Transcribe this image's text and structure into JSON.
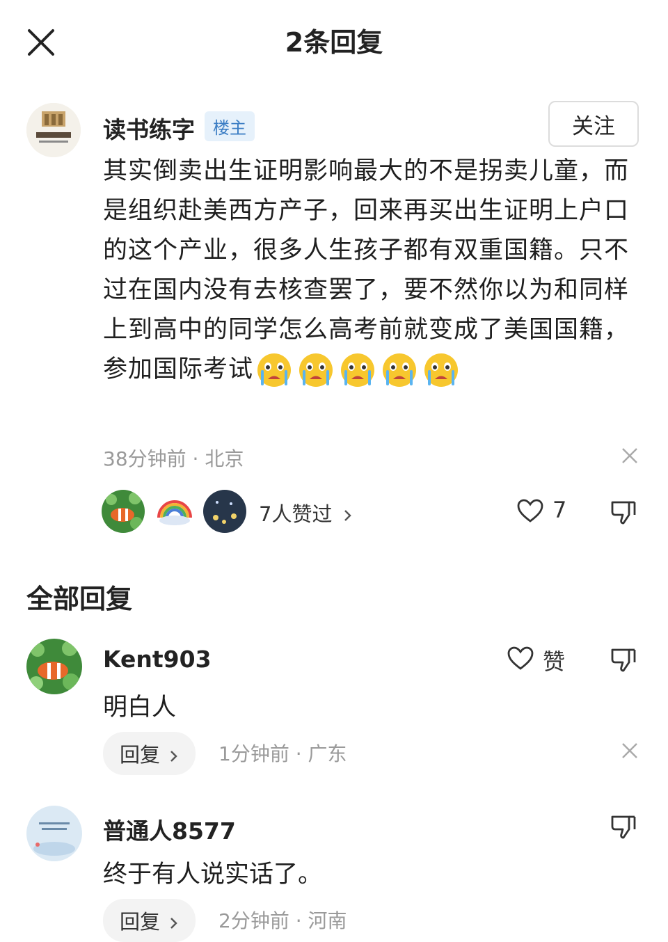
{
  "header": {
    "title": "2条回复"
  },
  "main_comment": {
    "author": "读书练字",
    "author_badge": "楼主",
    "follow_label": "关注",
    "text": "其实倒卖出生证明影响最大的不是拐卖儿童，而是组织赴美西方产子，回来再买出生证明上户口的这个产业，很多人生孩子都有双重国籍。只不过在国内没有去核查罢了，要不然你以为和同样上到高中的同学怎么高考前就变成了美国国籍，参加国际考试",
    "emoji_count": 5,
    "time": "38分钟前",
    "location": "北京",
    "likers_text": "7人赞过",
    "like_count": "7"
  },
  "replies_section": {
    "title": "全部回复"
  },
  "replies": [
    {
      "author": "Kent903",
      "text": "明白人",
      "like_label": "赞",
      "reply_label": "回复",
      "time": "1分钟前",
      "location": "广东"
    },
    {
      "author": "普通人8577",
      "text": "终于有人说实话了。",
      "reply_label": "回复",
      "time": "2分钟前",
      "location": "河南"
    }
  ],
  "icons": [
    "close-icon",
    "heart-icon",
    "thumb-down-icon",
    "chevron-right-icon",
    "dismiss-icon",
    "crying-face-emoji"
  ],
  "colors": {
    "badge_bg": "#e6f1fb",
    "badge_text": "#3b7dc4",
    "meta_text": "#9a9a9a"
  }
}
